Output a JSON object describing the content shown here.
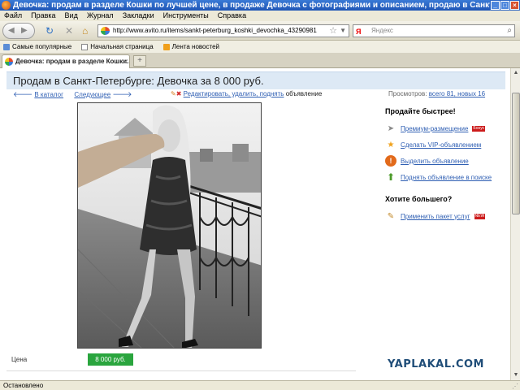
{
  "window": {
    "title": "Девочка: продам в разделе Кошки по лучшей цене, в продаже Девочка с фотографиями и описанием, продаю в Санкт-Петербург - Девочка на сайте доски бе..."
  },
  "menu": [
    "Файл",
    "Правка",
    "Вид",
    "Журнал",
    "Закладки",
    "Инструменты",
    "Справка"
  ],
  "toolbar": {
    "url": "http://www.avito.ru/items/sankt-peterburg_koshki_devochka_43290981",
    "search_placeholder": "Яндекс",
    "search_engine_glyph": "Я"
  },
  "bookmarks": [
    "Самые популярные",
    "Начальная страница",
    "Лента новостей"
  ],
  "tab": {
    "label": "Девочка: продам в разделе Кошки...",
    "new_tab": "+"
  },
  "page": {
    "title": "Продам в Санкт-Петербурге: Девочка за 8 000 руб.",
    "back_link": "В каталог",
    "next_link": "Следующее",
    "edit_link": "Редактировать, удалить, поднять",
    "edit_suffix": "объявление",
    "views_label": "Просмотров:",
    "views_total": "всего 81, новых 16",
    "price_label": "Цена",
    "price_value": "8 000 руб."
  },
  "sidebar": {
    "sell_heading": "Продайте быстрее!",
    "sell_items": [
      {
        "label": "Премиум-размещение",
        "icon": "paper-plane-icon",
        "badge": "Бонус"
      },
      {
        "label": "Сделать VIP-объявлением",
        "icon": "star-icon"
      },
      {
        "label": "Выделить объявление",
        "icon": "exclamation-icon"
      },
      {
        "label": "Поднять объявление в поиске",
        "icon": "up-arrow-icon"
      }
    ],
    "more_heading": "Хотите большего?",
    "more_items": [
      {
        "label": "Применить пакет услуг",
        "icon": "package-icon",
        "badge": "NEW"
      }
    ]
  },
  "watermark": "YAPLAKAL.COM",
  "status": "Остановлено",
  "colors": {
    "title_bg": "#dde9f5",
    "link": "#2f5fb3",
    "price_bg": "#2aa53e",
    "watermark": "#1f4d78"
  }
}
